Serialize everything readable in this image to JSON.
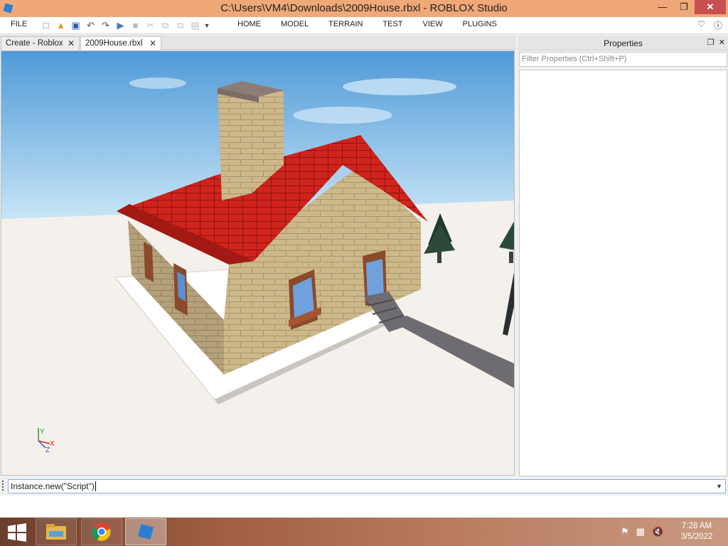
{
  "window": {
    "title": "C:\\Users\\VM4\\Downloads\\2009House.rbxl - ROBLOX Studio",
    "minimize_icon": "minimize-icon",
    "maximize_icon": "restore-icon",
    "close_icon": "close-icon"
  },
  "menubar": {
    "file_label": "FILE",
    "tabs": [
      "HOME",
      "MODEL",
      "TERRAIN",
      "TEST",
      "VIEW",
      "PLUGINS"
    ],
    "quick_access_icons": [
      "new-file-icon",
      "open-file-icon",
      "save-icon",
      "undo-icon",
      "redo-icon",
      "publish-icon",
      "stop-icon",
      "cut-icon",
      "copy-icon",
      "duplicate-icon",
      "paste-icon",
      "dropdown-icon"
    ]
  },
  "document_tabs": [
    {
      "label": "Create - Roblox",
      "active": false
    },
    {
      "label": "2009House.rbxl",
      "active": true
    }
  ],
  "viewport": {
    "axis_labels": {
      "x": "X",
      "y": "Y",
      "z": "Z"
    },
    "colors": {
      "sky_top": "#4f9ad8",
      "sky_bottom": "#bfe0f4",
      "baseplate": "#f4f1ec",
      "roof": "#d0231c",
      "brick": "#cdb88a",
      "window_frame": "#8a4a2c",
      "stairs": "#6e6c70"
    }
  },
  "properties": {
    "title": "Properties",
    "filter_placeholder": "Filter Properties (Ctrl+Shift+P)"
  },
  "command_bar": {
    "value": "Instance.new(\"Script\")"
  },
  "taskbar": {
    "apps": [
      "file-explorer-icon",
      "chrome-icon",
      "roblox-studio-icon"
    ],
    "tray_icons": [
      "flag-icon",
      "network-icon",
      "volume-muted-icon"
    ],
    "time": "7:28 AM",
    "date": "3/5/2022"
  }
}
